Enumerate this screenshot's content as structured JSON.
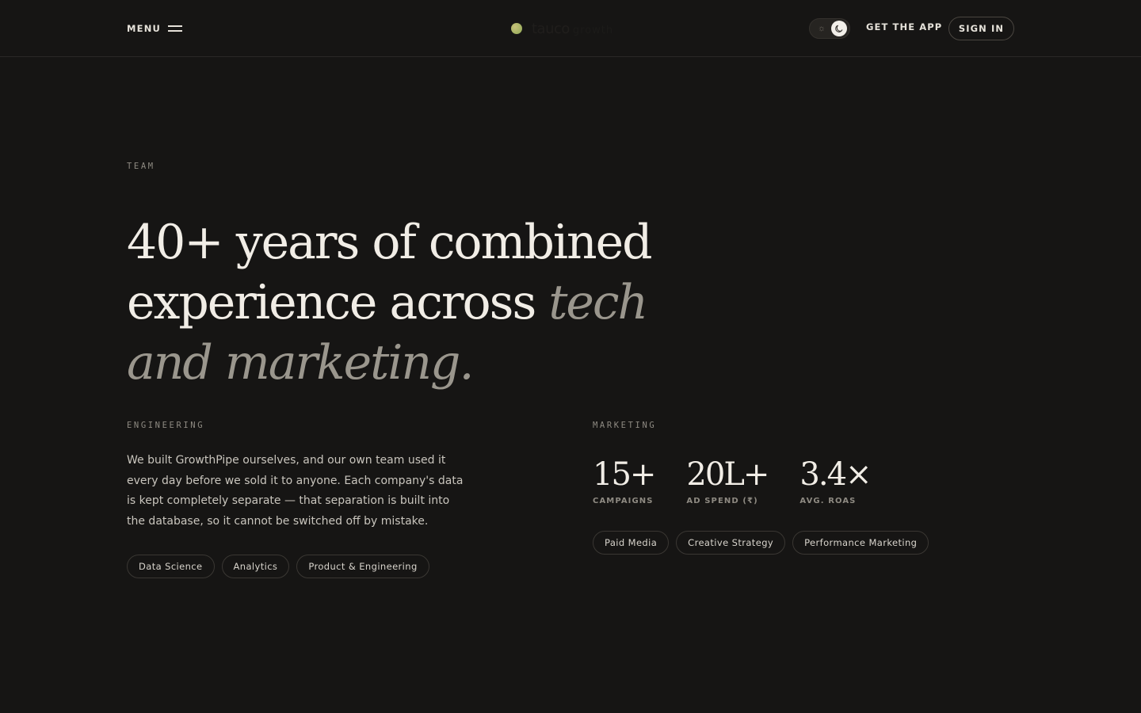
{
  "header": {
    "menu_label": "MENU",
    "logo_text": "tauco",
    "logo_subtext": "growth",
    "get_app_label": "GET THE APP",
    "sign_in_label": "SIGN IN",
    "theme_mode": "dark"
  },
  "team": {
    "eyebrow": "TEAM",
    "headline_plain": "40+ years of combined experience across ",
    "headline_italic": "tech and marketing."
  },
  "engineering": {
    "eyebrow": "ENGINEERING",
    "body": "We built GrowthPipe ourselves, and our own team used it every day before we sold it to anyone. Each company's data is kept completely separate — that separation is built into the database, so it cannot be switched off by mistake.",
    "tags": [
      "Data Science",
      "Analytics",
      "Product & Engineering"
    ]
  },
  "marketing": {
    "eyebrow": "MARKETING",
    "stats": [
      {
        "value": "15+",
        "label": "CAMPAIGNS"
      },
      {
        "value": "20L+",
        "label": "AD SPEND (₹)"
      },
      {
        "value": "3.4×",
        "label": "AVG. ROAS"
      }
    ],
    "tags": [
      "Paid Media",
      "Creative Strategy",
      "Performance Marketing"
    ]
  },
  "colors": {
    "background": "#161514",
    "text": "#f1ede6",
    "muted": "#8e8a82",
    "italic_accent": "#9a968d",
    "logo_dot": "#a8b45f"
  }
}
